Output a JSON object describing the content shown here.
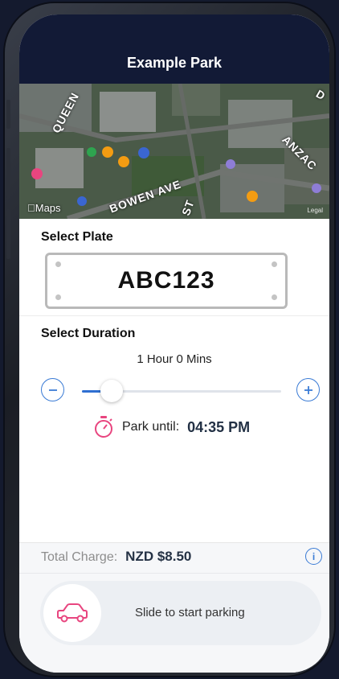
{
  "header": {
    "title": "Example Park"
  },
  "map": {
    "labels": [
      "QUEEN",
      "ANZAC",
      "BOWEN AVE",
      "ST",
      "D"
    ],
    "brand": "Maps",
    "legal": "Legal"
  },
  "plate": {
    "section_label": "Select Plate",
    "number": "ABC123"
  },
  "duration": {
    "section_label": "Select Duration",
    "value_text": "1 Hour  0 Mins",
    "slider_fraction": 0.15,
    "park_until_label": "Park until:",
    "park_until_time": "04:35 PM"
  },
  "charge": {
    "label": "Total Charge:",
    "value": "NZD $8.50",
    "info_icon": "info-icon"
  },
  "slider": {
    "label": "Slide to start parking",
    "icon": "car-icon"
  },
  "colors": {
    "header_bg": "#121a36",
    "accent_blue": "#3a7bd5",
    "accent_pink": "#e8457f"
  }
}
